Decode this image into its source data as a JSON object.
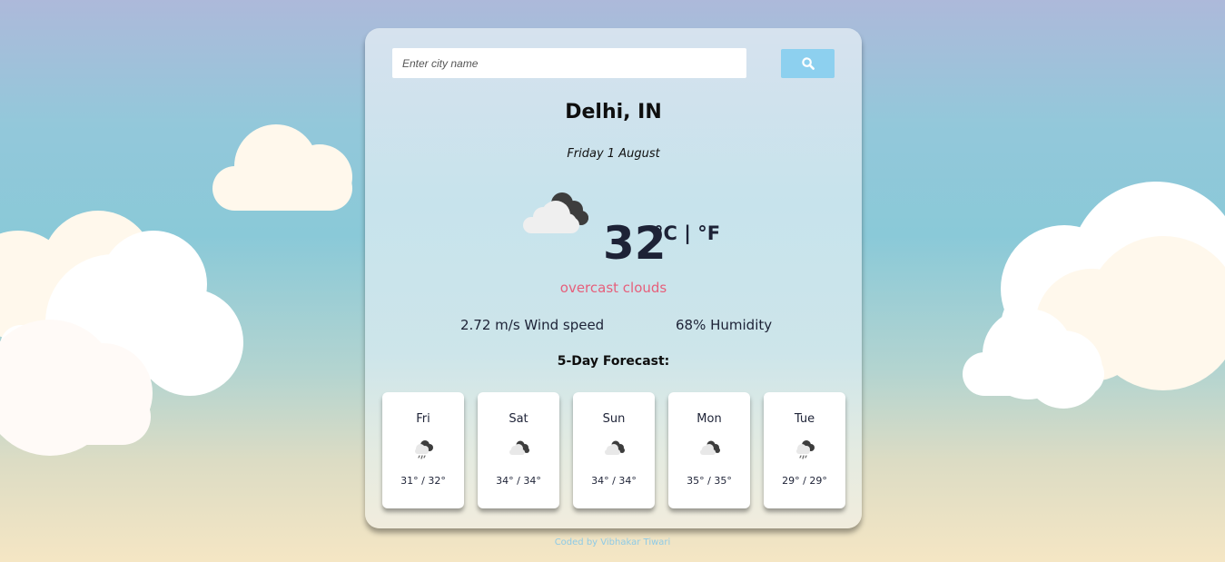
{
  "search": {
    "placeholder": "Enter city name",
    "button_icon": "search-icon"
  },
  "current": {
    "city": "Delhi, IN",
    "date": "Friday 1 August",
    "temperature": "32",
    "unit_celsius": "°C",
    "unit_separator": "|",
    "unit_fahrenheit": "°F",
    "description": "overcast clouds",
    "wind": "2.72 m/s Wind speed",
    "humidity": "68% Humidity",
    "icon": "overcast-clouds-icon"
  },
  "forecast": {
    "title": "5-Day Forecast:",
    "days": [
      {
        "day": "Fri",
        "temps": "31° / 32°",
        "icon": "rain-cloud-icon"
      },
      {
        "day": "Sat",
        "temps": "34° / 34°",
        "icon": "overcast-clouds-icon"
      },
      {
        "day": "Sun",
        "temps": "34° / 34°",
        "icon": "overcast-clouds-icon"
      },
      {
        "day": "Mon",
        "temps": "35° / 35°",
        "icon": "overcast-clouds-icon"
      },
      {
        "day": "Tue",
        "temps": "29° / 29°",
        "icon": "rain-cloud-icon"
      }
    ]
  },
  "footer": {
    "credit": "Coded by Vibhakar Tiwari"
  },
  "colors": {
    "accent_button": "#8dd0ef",
    "description_text": "#e65f7b",
    "footer_text": "#8ecae6"
  }
}
